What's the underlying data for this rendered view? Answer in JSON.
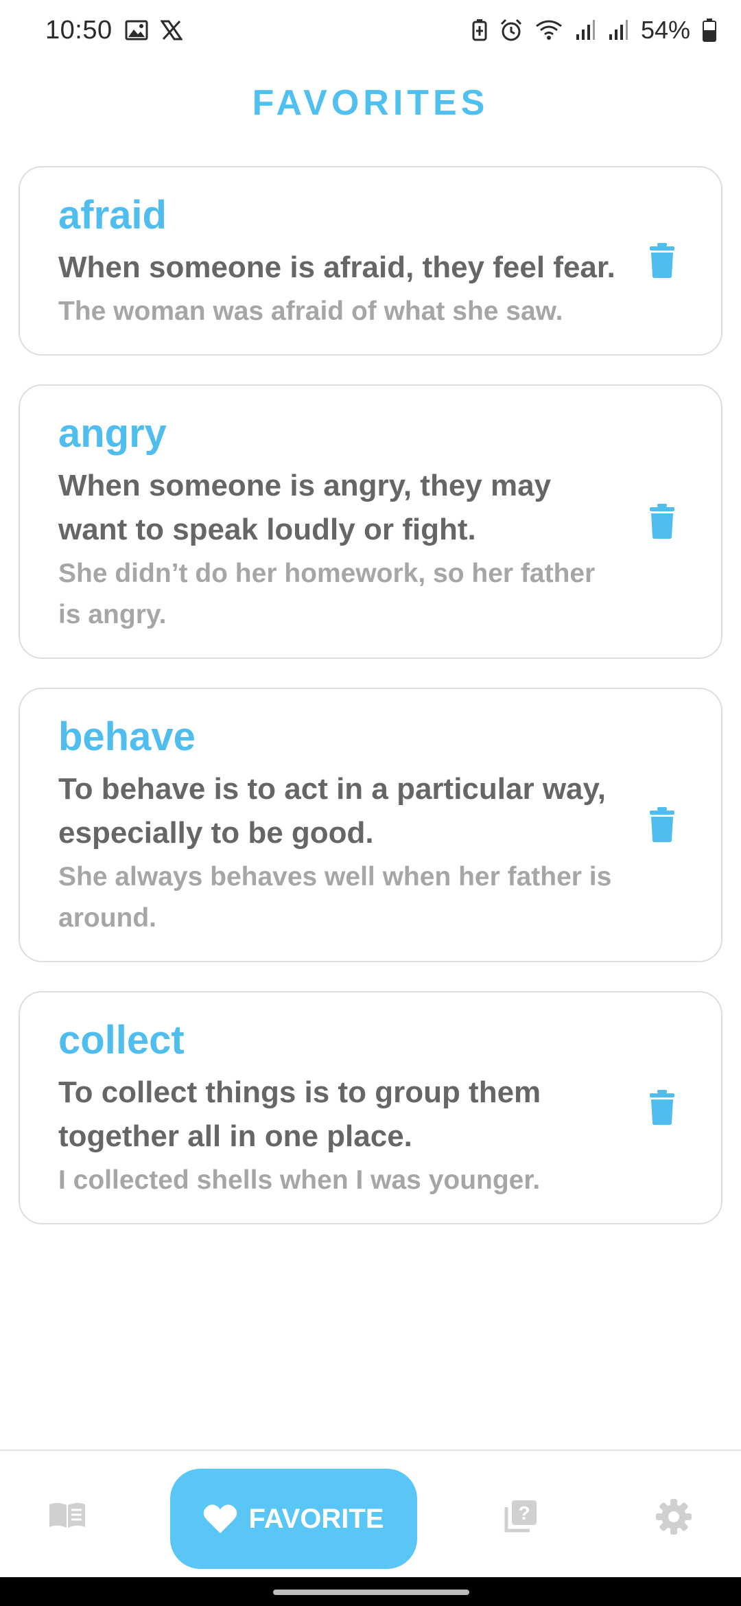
{
  "status_bar": {
    "time": "10:50",
    "battery_percent": "54%",
    "icons": [
      "gallery-icon",
      "x-logo-icon",
      "battery-saver-icon",
      "alarm-icon",
      "wifi-icon",
      "signal-icon",
      "signal-icon",
      "battery-icon"
    ]
  },
  "page": {
    "title": "FAVORITES"
  },
  "favorites": [
    {
      "word": "afraid",
      "definition": "When someone is afraid, they feel fear.",
      "example": "The woman was afraid of what she saw."
    },
    {
      "word": "angry",
      "definition": "When someone is angry, they may want to speak loudly or fight.",
      "example": "She didn’t do her homework, so her father is angry."
    },
    {
      "word": "behave",
      "definition": "To behave is to act in a particular way, especially to be good.",
      "example": "She always behaves well when her father is around."
    },
    {
      "word": "collect",
      "definition": "To collect things is to group them together all in one place.",
      "example": "I collected shells when I was younger."
    }
  ],
  "bottom_nav": {
    "items": [
      {
        "icon": "book-icon",
        "active": false
      },
      {
        "icon": "heart-icon",
        "label": "FAVORITE",
        "active": true
      },
      {
        "icon": "quiz-icon",
        "active": false
      },
      {
        "icon": "gear-icon",
        "active": false
      }
    ]
  },
  "colors": {
    "accent": "#4fc0f0",
    "active_tab_bg": "#5ac6f6",
    "definition_text": "#666666",
    "example_text": "#a6a6a6",
    "inactive_icon": "#d0d0d0"
  }
}
